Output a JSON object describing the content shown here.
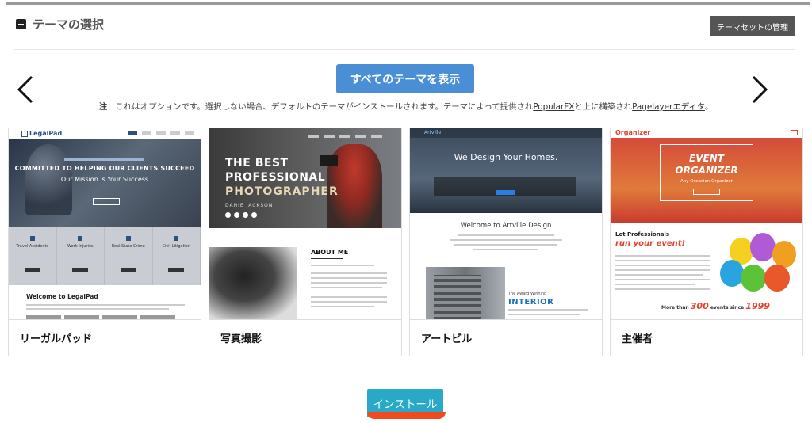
{
  "header": {
    "title": "テーマの選択",
    "manage_button": "テーマセットの管理"
  },
  "actions": {
    "show_all": "すべてのテーマを表示",
    "install": "インストール"
  },
  "note": {
    "prefix": "注",
    "text_1": "：これはオプションです。選択しない場合、デフォルトのテーマがインストールされます。テーマによって提供され",
    "link_1": "PopularFX",
    "text_2": "と上に構築され",
    "link_2": "Pagelayerエディタ",
    "text_3": "。"
  },
  "themes": [
    {
      "name": "リーガルパッド",
      "preview": {
        "logo": "LegalPad",
        "headline": "COMMITTED TO HELPING OUR CLIENTS SUCCEED",
        "subheadline": "Our Mission is Your Success",
        "features": [
          "Travel Accidents",
          "Work Injuries",
          "Real State Crime",
          "Civil Litigation"
        ],
        "welcome": "Welcome to LegalPad"
      }
    },
    {
      "name": "写真撮影",
      "preview": {
        "line_1": "THE BEST",
        "line_2": "PROFESSIONAL",
        "line_3": "PHOTOGRAPHER",
        "author": "DANIE JACKSON",
        "about": "ABOUT ME"
      }
    },
    {
      "name": "アートビル",
      "preview": {
        "logo": "Artville",
        "headline": "We Design Your Homes.",
        "welcome": "Welcome to Artville Design",
        "award": "The Award Winning",
        "interior": "INTERIOR"
      }
    },
    {
      "name": "主催者",
      "preview": {
        "logo": "Organizer",
        "event_1": "EVENT",
        "event_2": "ORGANIZER",
        "tagline": "Any Occasion Organizer",
        "lead": "Let Professionals",
        "run": "run your event!",
        "stat_prefix": "More than",
        "stat_count": "300",
        "stat_mid": "events since",
        "stat_year": "1999"
      }
    }
  ],
  "colors": {
    "primary_button": "#4a8fd6",
    "install_button": "#27a9c7",
    "highlight": "#f04a1e",
    "manage_button": "#555555"
  }
}
